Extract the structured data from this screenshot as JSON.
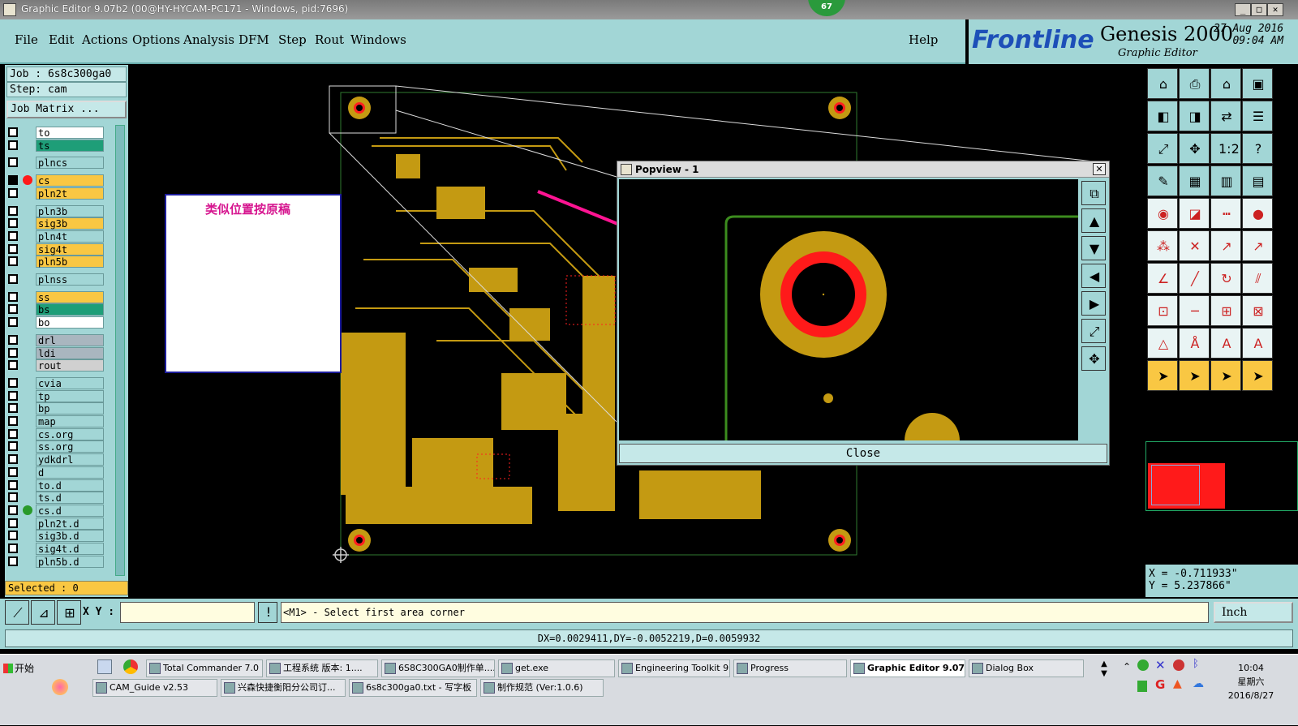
{
  "window": {
    "title": "Graphic Editor 9.07b2 (00@HY-HYCAM-PC171 - Windows, pid:7696)",
    "badge": "67",
    "min": "_",
    "max": "□",
    "close": "✕"
  },
  "menu": [
    "File",
    "Edit",
    "Actions",
    "Options",
    "Analysis",
    "DFM",
    "Step",
    "Rout",
    "Windows"
  ],
  "help": "Help",
  "brand": {
    "logo": "Frontline",
    "product": "Genesis 2000",
    "subtitle": "Graphic Editor",
    "date": "27 Aug 2016",
    "time": "09:04 AM"
  },
  "job": {
    "job_line": "Job : 6s8c300ga0",
    "step_line": "Step: cam",
    "matrix_btn": "Job Matrix ..."
  },
  "layers": [
    {
      "name": "to",
      "color": "#ffffff"
    },
    {
      "name": "ts",
      "color": "#1e9e78"
    },
    {
      "name": "plncs",
      "color": "#a2d6d6"
    },
    {
      "name": "cs",
      "color": "#f9c743",
      "work": true
    },
    {
      "name": "pln2t",
      "color": "#f9c743"
    },
    {
      "name": "pln3b",
      "color": "#a2d6d6"
    },
    {
      "name": "sig3b",
      "color": "#f9c743"
    },
    {
      "name": "pln4t",
      "color": "#a2d6d6"
    },
    {
      "name": "sig4t",
      "color": "#f9c743"
    },
    {
      "name": "pln5b",
      "color": "#f9c743"
    },
    {
      "name": "plnss",
      "color": "#a2d6d6"
    },
    {
      "name": "ss",
      "color": "#f9c743"
    },
    {
      "name": "bs",
      "color": "#1e9e78"
    },
    {
      "name": "bo",
      "color": "#ffffff"
    },
    {
      "name": "drl",
      "color": "#a9b6bf"
    },
    {
      "name": "ldi",
      "color": "#a9b6bf"
    },
    {
      "name": "rout",
      "color": "#d0d0d0"
    },
    {
      "name": "cvia",
      "color": "#a2d6d6"
    },
    {
      "name": "tp",
      "color": "#a2d6d6"
    },
    {
      "name": "bp",
      "color": "#a2d6d6"
    },
    {
      "name": "map",
      "color": "#a2d6d6"
    },
    {
      "name": "cs.org",
      "color": "#a2d6d6"
    },
    {
      "name": "ss.org",
      "color": "#a2d6d6"
    },
    {
      "name": "ydkdrl",
      "color": "#a2d6d6"
    },
    {
      "name": "d",
      "color": "#a2d6d6"
    },
    {
      "name": "to.d",
      "color": "#a2d6d6"
    },
    {
      "name": "ts.d",
      "color": "#a2d6d6"
    },
    {
      "name": "cs.d",
      "color": "#a2d6d6",
      "green": true
    },
    {
      "name": "pln2t.d",
      "color": "#a2d6d6"
    },
    {
      "name": "sig3b.d",
      "color": "#a2d6d6"
    },
    {
      "name": "sig4t.d",
      "color": "#a2d6d6"
    },
    {
      "name": "pln5b.d",
      "color": "#a2d6d6"
    }
  ],
  "selected": "Selected : 0",
  "note_text": "类似位置按原稿",
  "popview": {
    "title": "Popview - 1",
    "close_label": "Close"
  },
  "coords": {
    "x": "X = -0.711933\"",
    "y": "Y = 5.237866\""
  },
  "cmd": {
    "xy_label": "X Y :",
    "prompt": "<M1> - Select first area corner",
    "units": "Inch"
  },
  "status": "DX=0.0029411,DY=-0.0052219,D=0.0059932",
  "taskbar": {
    "start": "开始",
    "row1": [
      "Total Commander 7.0 ...",
      "工程系统  版本: 1....",
      "6S8C300GA0制作单....",
      "get.exe",
      "Engineering Toolkit 9....",
      "Progress",
      "Graphic Editor 9.07...",
      "Dialog Box"
    ],
    "row2": [
      "CAM_Guide v2.53",
      "兴森快捷衡阳分公司订...",
      "6s8c300ga0.txt - 写字板",
      "制作规范 (Ver:1.0.6)"
    ],
    "clock": {
      "time": "10:04",
      "day": "星期六",
      "date": "2016/8/27"
    }
  },
  "colors": {
    "panel": "#a2d6d6",
    "copper": "#c49a12",
    "pad_red": "#ff1a1a",
    "arrow": "#ff1493"
  }
}
